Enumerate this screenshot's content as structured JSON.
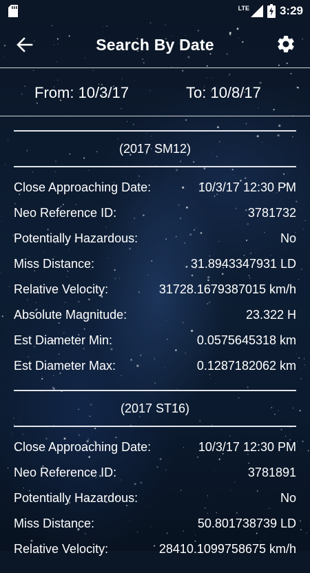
{
  "status_bar": {
    "network": "LTE",
    "battery_level": 0.55,
    "time": "3:29"
  },
  "toolbar": {
    "title": "Search By Date",
    "back_icon": "arrow-left-icon",
    "settings_icon": "gear-icon"
  },
  "date_range": {
    "from": "From: 10/3/17",
    "to": "To: 10/8/17"
  },
  "neos": [
    {
      "name": "(2017 SM12)",
      "rows": [
        {
          "label": "Close Approaching Date:",
          "value": "10/3/17 12:30 PM"
        },
        {
          "label": "Neo Reference ID:",
          "value": "3781732"
        },
        {
          "label": "Potentially Hazardous:",
          "value": "No"
        },
        {
          "label": "Miss Distance:",
          "value": "31.8943347931 LD"
        },
        {
          "label": "Relative Velocity:",
          "value": "31728.1679387015 km/h"
        },
        {
          "label": "Absolute Magnitude:",
          "value": "23.322 H"
        },
        {
          "label": "Est Diameter Min:",
          "value": "0.0575645318 km"
        },
        {
          "label": "Est Diameter Max:",
          "value": "0.1287182062 km"
        }
      ]
    },
    {
      "name": "(2017 ST16)",
      "rows": [
        {
          "label": "Close Approaching Date:",
          "value": "10/3/17 12:30 PM"
        },
        {
          "label": "Neo Reference ID:",
          "value": "3781891"
        },
        {
          "label": "Potentially Hazardous:",
          "value": "No"
        },
        {
          "label": "Miss Distance:",
          "value": "50.801738739 LD"
        },
        {
          "label": "Relative Velocity:",
          "value": "28410.1099758675 km/h"
        }
      ]
    }
  ]
}
